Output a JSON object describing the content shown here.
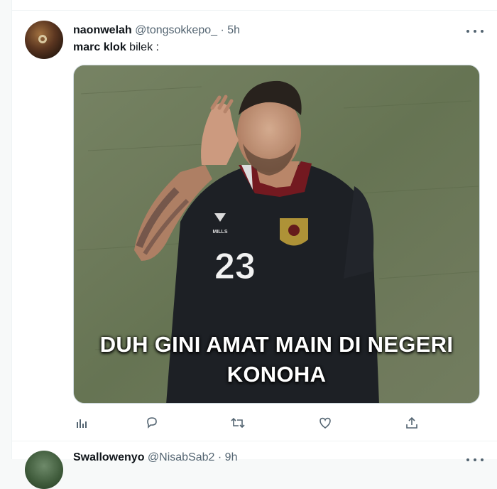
{
  "tweet": {
    "display_name": "naonwelah",
    "handle": "@tongsokkepo_",
    "separator": "·",
    "time": "5h",
    "text_bold": "marc klok",
    "text_rest": " bilek :",
    "media": {
      "caption_line1": "DUH GINI AMAT MAIN DI NEGERI",
      "caption_line2": "KONOHA",
      "jersey_number": "23",
      "jersey_brand": "MILLS"
    },
    "actions": [
      "analytics-icon",
      "reply-icon",
      "retweet-icon",
      "like-icon",
      "share-icon"
    ]
  },
  "next_tweet": {
    "display_name": "Swallowenyo",
    "handle": "@NisabSab2",
    "separator": "·",
    "time": "9h"
  },
  "colors": {
    "text_primary": "#0f1419",
    "text_secondary": "#536471",
    "border": "#eff3f4",
    "caption_text": "#ffffff"
  }
}
